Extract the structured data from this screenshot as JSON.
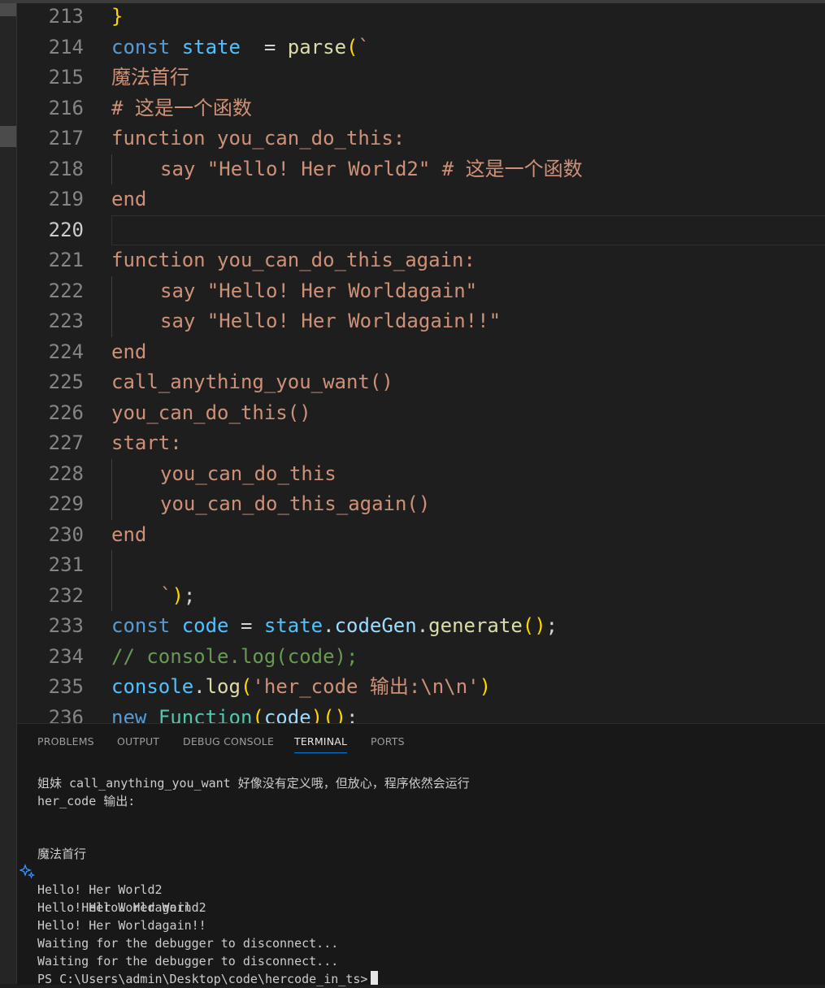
{
  "editor": {
    "current_line": "220",
    "lines": [
      {
        "num": "213",
        "t": [
          "}"
        ]
      },
      {
        "num": "214",
        "t": [
          "const",
          "state",
          "=",
          "parse",
          "(",
          "`"
        ]
      },
      {
        "num": "215",
        "t": [
          "魔法首行"
        ]
      },
      {
        "num": "216",
        "t": [
          "# 这是一个函数"
        ]
      },
      {
        "num": "217",
        "t": [
          "function you_can_do_this:"
        ]
      },
      {
        "num": "218",
        "t": [
          "say \"Hello! Her World2\" # 这是一个函数"
        ]
      },
      {
        "num": "219",
        "t": [
          "end"
        ]
      },
      {
        "num": "220",
        "t": []
      },
      {
        "num": "221",
        "t": [
          "function you_can_do_this_again:"
        ]
      },
      {
        "num": "222",
        "t": [
          "say \"Hello! Her Worldagain\""
        ]
      },
      {
        "num": "223",
        "t": [
          "say \"Hello! Her Worldagain!!\""
        ]
      },
      {
        "num": "224",
        "t": [
          "end"
        ]
      },
      {
        "num": "225",
        "t": [
          "call_anything_you_want()"
        ]
      },
      {
        "num": "226",
        "t": [
          "you_can_do_this()"
        ]
      },
      {
        "num": "227",
        "t": [
          "start:"
        ]
      },
      {
        "num": "228",
        "t": [
          "you_can_do_this"
        ]
      },
      {
        "num": "229",
        "t": [
          "you_can_do_this_again()"
        ]
      },
      {
        "num": "230",
        "t": [
          "end"
        ]
      },
      {
        "num": "231",
        "t": []
      },
      {
        "num": "232",
        "t": [
          "`",
          ")",
          ";"
        ]
      },
      {
        "num": "233",
        "t": [
          "const",
          "code",
          "=",
          "state",
          ".",
          "codeGen",
          ".",
          "generate",
          "(",
          ")",
          ";"
        ]
      },
      {
        "num": "234",
        "t": [
          "// console.log(code);"
        ]
      },
      {
        "num": "235",
        "t": [
          "console",
          ".",
          "log",
          "(",
          "'her_code 输出:\\n\\n'",
          ")"
        ]
      },
      {
        "num": "236",
        "t": [
          "new",
          "Function",
          "(",
          "code",
          ")",
          "(",
          ")",
          ";"
        ]
      }
    ]
  },
  "panel": {
    "tabs": [
      "PROBLEMS",
      "OUTPUT",
      "DEBUG CONSOLE",
      "TERMINAL",
      "PORTS"
    ],
    "active_tab": "TERMINAL",
    "terminal_lines": [
      "姐妹 call_anything_you_want 好像没有定义哦，但放心，程序依然会运行",
      "her_code 输出:",
      "",
      "",
      "魔法首行",
      "Hello! Her World2",
      "Hello! Her World2",
      "Hello! Her Worldagain",
      "Hello! Her Worldagain!!",
      "Waiting for the debugger to disconnect...",
      "Waiting for the debugger to disconnect...",
      "PS C:\\Users\\admin\\Desktop\\code\\hercode_in_ts>"
    ]
  }
}
